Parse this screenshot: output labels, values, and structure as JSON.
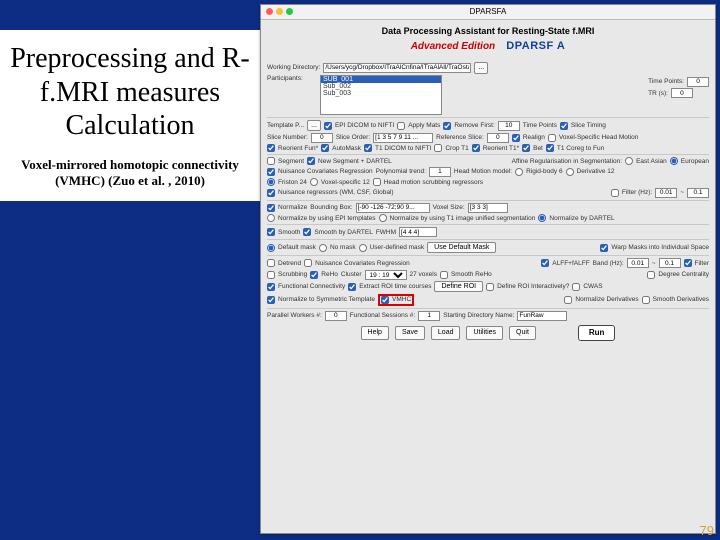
{
  "slide": {
    "title": "Preprocessing and R-f.MRI measures Calculation",
    "subtitle": "Voxel-mirrored homotopic connectivity (VMHC) (Zuo et al. , 2010)",
    "page": "79"
  },
  "win": {
    "title": "DPARSFA",
    "header": "Data Processing Assistant for Resting-State f.MRI",
    "advanced": "Advanced Edition",
    "brand": "DPARSF A",
    "wd_label": "Working Directory:",
    "wd_val": "/Users/ycg/Dropbox/ITraAlCnfina/ITraAlAll/TraOsta/DPARSF",
    "wd_btn": "...",
    "participants": "Participants:",
    "list": {
      "a": "SUB_001",
      "b": "Sub_002",
      "c": "Sub_003"
    },
    "tp_lbl": "Time Points:",
    "tp": "0",
    "tr_lbl": "TR (s):",
    "tr": "0",
    "tmpl": "Template P...",
    "tmpl_btn": "...",
    "epi": "EPI DICOM to NIFTI",
    "apm": "Apply Mats",
    "rmf": "Remove First:",
    "rmf_v": "10",
    "tp2": "Time Points",
    "st": "Slice Timing",
    "sn": "Slice Number:",
    "sn_v": "0",
    "so": "Slice Order:",
    "so_v": "[1 3 5 7 9 11 ...",
    "rs": "Reference Slice:",
    "rs_v": "0",
    "ra": "Realign",
    "vhm": "Voxel-Specific Head Motion",
    "reor": "Reorient Fun*",
    "am": "AutoMask",
    "t1d": "T1 DICOM to NIFTI",
    "ct1": "Crop T1",
    "rt1": "Reorient T1*",
    "bet": "Bet",
    "t1c": "T1 Coreg to Fun",
    "seg": "Segment",
    "nsd": "New Segment + DARTEL",
    "ars": "Affine Regularisation in Segmentation:",
    "ea": "East Asian",
    "eu": "European",
    "ncr": "Nuisance Covariates Regression",
    "pt": "Polynomial trend:",
    "pt_v": "1",
    "hmm": "Head Motion model:",
    "hmm_v": "Rigid-body 6",
    "dv": "Derivative 12",
    "f24": "Friston 24",
    "vs12": "Voxel-specific 12",
    "hms": "Head motion scrubbing regressors",
    "nrg": "Nuisance regressors (WM, CSF, Global)",
    "f_on": "Filter (Hz):",
    "f1": "0.01",
    "til": "~",
    "f2": "0.1",
    "norm": "Normalize",
    "bb": "Bounding Box:",
    "bb_v": "[-90 -126 -72;90 9...",
    "vs": "Voxel Size:",
    "vs_v": "[3 3 3]",
    "nep": "Normalize by using EPI templates",
    "nt1": "Normalize by using T1 image unified segmentation",
    "nd": "Normalize by DARTEL",
    "sm": "Smooth",
    "smd": "Smooth by DARTEL",
    "fw": "FWHM",
    "fw_v": "[4 4 4]",
    "dm": "Default mask",
    "nm": "No mask",
    "udm": "User-defined mask",
    "udm_btn": "Use Default Mask",
    "wmi": "Warp Masks into Individual Space",
    "dt": "Detrend",
    "ncr2": "Nuisance Covariates Regression",
    "alf": "ALFF+fALFF",
    "bh": "Band (Hz):",
    "fil": "Filter",
    "scr": "Scrubbing",
    "rh": "ReHo",
    "cl": "Cluster",
    "cl_v": "19 : 19",
    "vx": "27 voxels",
    "srh": "Smooth ReHo",
    "dc": "Degree Centrality",
    "fc": "Functional Connectivity",
    "ert": "Extract ROI time courses",
    "droi": "Define ROI",
    "droi2": "Define ROI Interactively?",
    "cw": "CWAS",
    "nst": "Normalize to Symmetric Template",
    "vm": "VMHC",
    "ndv": "Normalize Derivatives",
    "sd": "Smooth Derivatives",
    "pw": "Parallel Workers #:",
    "pw_v": "0",
    "fs": "Functional Sessions #:",
    "fs_v": "1",
    "sdn": "Starting Directory Name:",
    "sdn_v": "FunRaw",
    "b_help": "Help",
    "b_save": "Save",
    "b_load": "Load",
    "b_util": "Utilities",
    "b_quit": "Quit",
    "b_run": "Run"
  }
}
